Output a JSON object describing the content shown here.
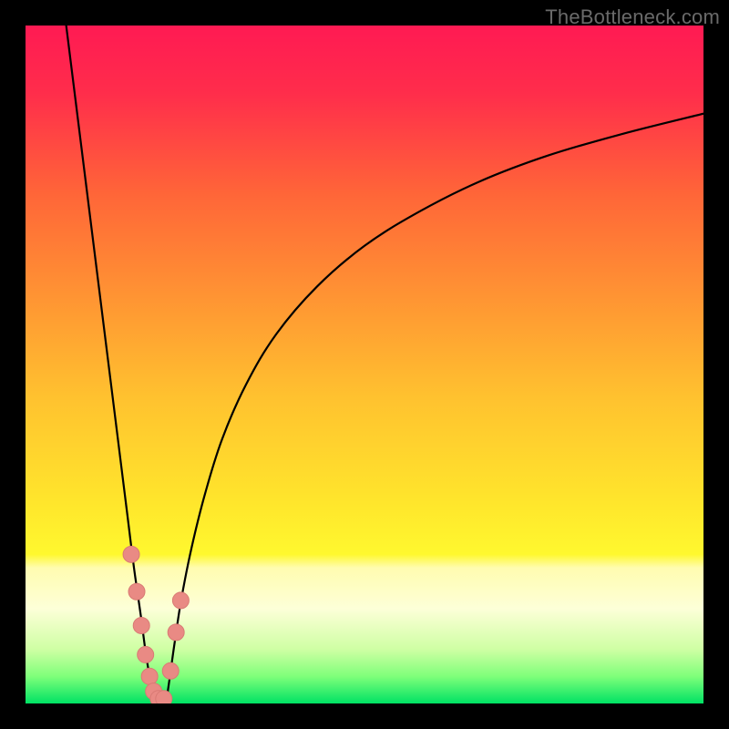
{
  "watermark": "TheBottleneck.com",
  "chart_data": {
    "type": "line",
    "title": "",
    "xlabel": "",
    "ylabel": "",
    "xlim": [
      0,
      100
    ],
    "ylim": [
      0,
      100
    ],
    "grid": false,
    "gradient_stops": [
      {
        "offset": 0.0,
        "color": "#ff1a53"
      },
      {
        "offset": 0.1,
        "color": "#ff2d4b"
      },
      {
        "offset": 0.25,
        "color": "#ff6638"
      },
      {
        "offset": 0.4,
        "color": "#ff9433"
      },
      {
        "offset": 0.55,
        "color": "#ffc22f"
      },
      {
        "offset": 0.7,
        "color": "#ffe52c"
      },
      {
        "offset": 0.78,
        "color": "#fff82e"
      },
      {
        "offset": 0.8,
        "color": "#fffcb0"
      },
      {
        "offset": 0.86,
        "color": "#fdffd8"
      },
      {
        "offset": 0.92,
        "color": "#cfffa4"
      },
      {
        "offset": 0.96,
        "color": "#7fff7a"
      },
      {
        "offset": 1.0,
        "color": "#00e264"
      }
    ],
    "series": [
      {
        "name": "curve-left",
        "stroke": "#000000",
        "stroke_width": 2.2,
        "x": [
          6.0,
          7.5,
          9.0,
          10.5,
          12.0,
          13.5,
          15.0,
          16.0,
          17.0,
          17.8,
          18.5,
          19.0
        ],
        "y": [
          100.0,
          88.0,
          76.0,
          64.0,
          52.0,
          40.0,
          28.0,
          20.0,
          13.0,
          7.0,
          3.0,
          0.5
        ]
      },
      {
        "name": "curve-right",
        "stroke": "#000000",
        "stroke_width": 2.2,
        "x": [
          20.8,
          21.3,
          22.0,
          23.0,
          24.5,
          26.5,
          29.0,
          32.5,
          37.0,
          43.0,
          50.0,
          58.0,
          67.0,
          77.0,
          88.0,
          100.0
        ],
        "y": [
          0.5,
          4.0,
          9.0,
          15.5,
          23.0,
          31.0,
          39.0,
          47.0,
          54.5,
          61.5,
          67.5,
          72.5,
          77.0,
          80.8,
          84.0,
          87.0
        ]
      }
    ],
    "markers": {
      "name": "markers-near-minimum",
      "fill": "#e98a84",
      "stroke": "#d97a74",
      "r": 9,
      "points": [
        {
          "x": 15.6,
          "y": 22.0
        },
        {
          "x": 16.4,
          "y": 16.5
        },
        {
          "x": 17.1,
          "y": 11.5
        },
        {
          "x": 17.7,
          "y": 7.2
        },
        {
          "x": 18.3,
          "y": 4.0
        },
        {
          "x": 18.9,
          "y": 1.8
        },
        {
          "x": 19.6,
          "y": 0.7
        },
        {
          "x": 20.4,
          "y": 0.7
        },
        {
          "x": 21.4,
          "y": 4.8
        },
        {
          "x": 22.2,
          "y": 10.5
        },
        {
          "x": 22.9,
          "y": 15.2
        }
      ]
    }
  }
}
